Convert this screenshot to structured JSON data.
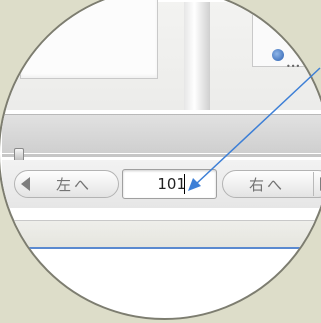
{
  "navigation": {
    "prev_label": "左へ",
    "next_label": "右へ",
    "page_input_value": "101"
  },
  "icons": {
    "prev_arrow": "triangle-left-icon",
    "next_arrow": "triangle-right-icon"
  },
  "colors": {
    "pointer": "#3d7fd6",
    "accent_line": "#5b8ad0",
    "background": "#ddddc9"
  }
}
